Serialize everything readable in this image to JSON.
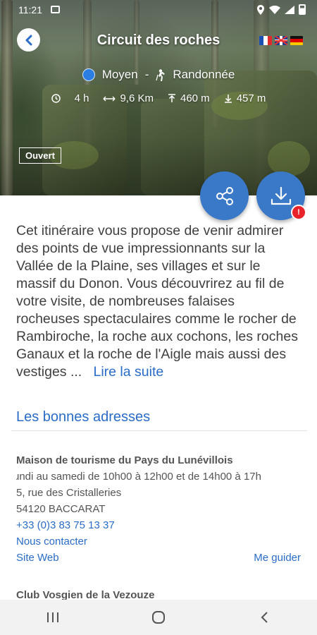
{
  "status_bar": {
    "time": "11:21"
  },
  "header": {
    "title": "Circuit des roches",
    "languages": [
      "Français",
      "English",
      "Deutsch"
    ]
  },
  "trail": {
    "difficulty": "Moyen",
    "separator": "-",
    "activity": "Randonnée",
    "duration": "4 h",
    "distance": "9,6 Km",
    "ascent": "460 m",
    "descent": "457 m",
    "status": "Ouvert"
  },
  "actions": {
    "notification_badge": "!"
  },
  "description": {
    "text": "Cet itinéraire vous propose de venir admirer des points de vue impressionnants sur la Vallée de la Plaine, ses villages et sur le massif du Donon. Vous découvrirez au fil de votre visite, de nombreuses falaises rocheuses spectaculaires comme le rocher de Rambiroche, la roche aux cochons, les roches Ganaux et la roche de l'Aigle mais aussi des vestiges ...",
    "read_more": "Lire la suite"
  },
  "addresses": {
    "section_title": "Les bonnes adresses",
    "items": [
      {
        "name": "Maison de tourisme du Pays du Lunévillois",
        "hours": "undi au samedi de 10h00 à 12h00 et de 14h00 à 17h",
        "street": "5, rue des Cristalleries",
        "city": "54120 BACCARAT",
        "phone": "+33 (0)3 83 75 13 37",
        "contact": "Nous contacter",
        "website": "Site Web",
        "guide": "Me guider"
      },
      {
        "name": "Club Vosgien de la Vezouze"
      }
    ]
  },
  "colors": {
    "accent": "#2a6cc7",
    "fab": "#3a78c8",
    "badge": "#e8222a",
    "difficulty": "#2a7de1"
  }
}
